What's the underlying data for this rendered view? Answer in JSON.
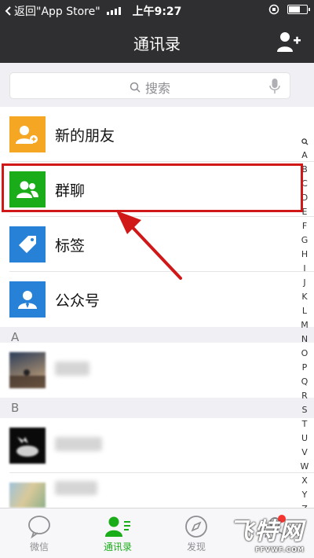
{
  "status_bar": {
    "back_label": "返回\"App Store\"",
    "time": "上午9:27"
  },
  "nav": {
    "title": "通讯录"
  },
  "search": {
    "placeholder": "搜索"
  },
  "special_rows": [
    {
      "label": "新的朋友",
      "icon": "add-friend-icon",
      "color": "#f5a623"
    },
    {
      "label": "群聊",
      "icon": "group-icon",
      "color": "#1aad19"
    },
    {
      "label": "标签",
      "icon": "tag-icon",
      "color": "#2782d7"
    },
    {
      "label": "公众号",
      "icon": "official-account-icon",
      "color": "#2782d7"
    }
  ],
  "sections": [
    {
      "letter": "A"
    },
    {
      "letter": "B"
    }
  ],
  "index_letters": [
    "A",
    "B",
    "C",
    "D",
    "E",
    "F",
    "G",
    "H",
    "I",
    "J",
    "K",
    "L",
    "M",
    "N",
    "O",
    "P",
    "Q",
    "R",
    "S",
    "T",
    "U",
    "V",
    "W",
    "X",
    "Y",
    "Z",
    "#"
  ],
  "tabs": [
    {
      "label": "微信",
      "icon": "chat-icon",
      "active": false
    },
    {
      "label": "通讯录",
      "icon": "contacts-icon",
      "active": true
    },
    {
      "label": "发现",
      "icon": "compass-icon",
      "active": false
    },
    {
      "label": "",
      "icon": "me-icon",
      "active": false
    }
  ],
  "colors": {
    "accent": "#1aad19",
    "highlight_box": "#d01818",
    "nav_bg": "#2f2f31"
  },
  "watermark": {
    "text": "飞特网",
    "url": "FFVWF.COM"
  }
}
